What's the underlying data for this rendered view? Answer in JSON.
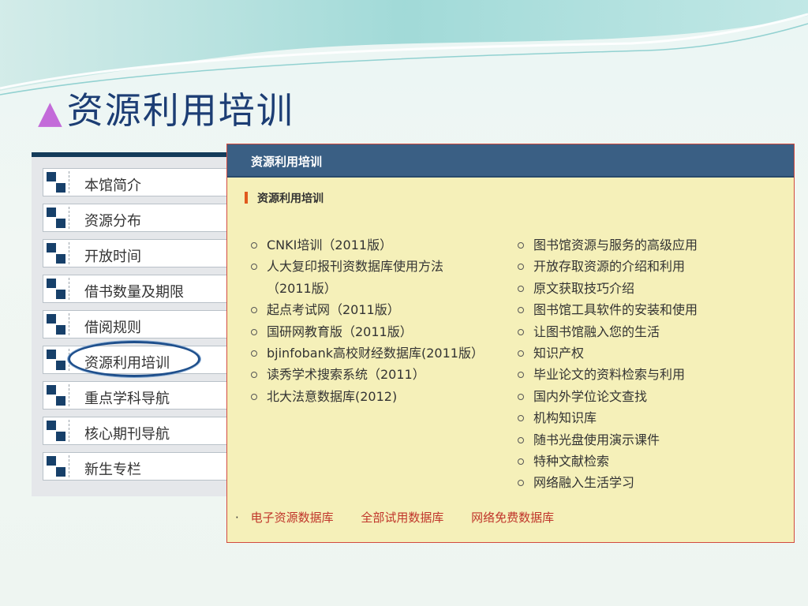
{
  "slide": {
    "title_marker": "▲",
    "title": "资源利用培训"
  },
  "left_nav": {
    "items": [
      {
        "label": "本馆简介"
      },
      {
        "label": "资源分布"
      },
      {
        "label": "开放时间"
      },
      {
        "label": "借书数量及期限"
      },
      {
        "label": "借阅规则"
      },
      {
        "label": "资源利用培训",
        "selected": true
      },
      {
        "label": "重点学科导航"
      },
      {
        "label": "核心期刊导航"
      },
      {
        "label": "新生专栏"
      }
    ]
  },
  "panel": {
    "header": "资源利用培训",
    "section_title": "资源利用培训",
    "left_items": [
      {
        "label": "CNKI培训（2011版）"
      },
      {
        "label": "人大复印报刊资数据库使用方法"
      },
      {
        "label": "（2011版）"
      },
      {
        "label": "起点考试网（2011版）"
      },
      {
        "label": "国研网教育版（2011版）"
      },
      {
        "label": "bjinfobank高校财经数据库(2011版）"
      },
      {
        "label": "读秀学术搜索系统（2011）"
      },
      {
        "label": "北大法意数据库(2012)"
      }
    ],
    "right_items": [
      {
        "label": "图书馆资源与服务的高级应用"
      },
      {
        "label": "开放存取资源的介绍和利用"
      },
      {
        "label": "原文获取技巧介绍"
      },
      {
        "label": "图书馆工具软件的安装和使用"
      },
      {
        "label": "让图书馆融入您的生活"
      },
      {
        "label": "知识产权"
      },
      {
        "label": "毕业论文的资料检索与利用"
      },
      {
        "label": "国内外学位论文查找"
      },
      {
        "label": "机构知识库"
      },
      {
        "label": "随书光盘使用演示课件"
      },
      {
        "label": "特种文献检索"
      },
      {
        "label": "网络融入生活学习"
      }
    ],
    "footer_links": [
      {
        "label": "电子资源数据库"
      },
      {
        "label": "全部试用数据库"
      },
      {
        "label": "网络免费数据库"
      }
    ],
    "footer_bullet": "·"
  },
  "colors": {
    "header_bg": "#3a5f84",
    "panel_bg": "#f5f0b9",
    "link_red": "#c0352a",
    "title_blue": "#1c3d74",
    "marker_purple": "#c36bd9"
  }
}
